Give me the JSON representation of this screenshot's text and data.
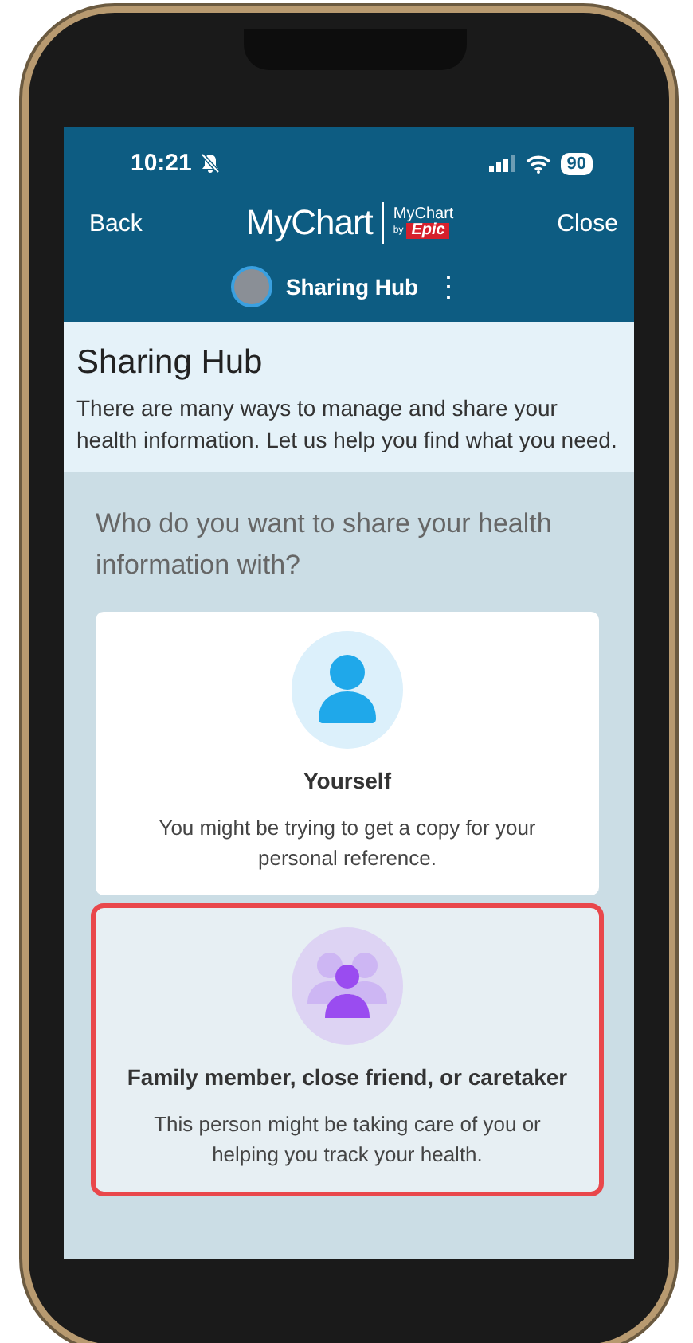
{
  "status_bar": {
    "time": "10:21",
    "battery": "90"
  },
  "nav": {
    "back": "Back",
    "logo": "MyChart",
    "partner_logo": {
      "name": "MyChart",
      "by": "by",
      "brand": "Epic"
    },
    "close": "Close"
  },
  "context": {
    "title": "Sharing Hub",
    "menu": "⋮"
  },
  "header": {
    "title": "Sharing Hub",
    "text": "There are many ways to manage and share your health information. Let us help you find what you need."
  },
  "question": "Who do you want to share your health information with?",
  "options": [
    {
      "kind": "self",
      "title": "Yourself",
      "text": "You might be trying to get a copy for your personal reference.",
      "highlighted": false
    },
    {
      "kind": "group",
      "title": "Family member, close friend, or caretaker",
      "text": "This person might be taking care of you or helping you track your health.",
      "highlighted": true
    }
  ]
}
